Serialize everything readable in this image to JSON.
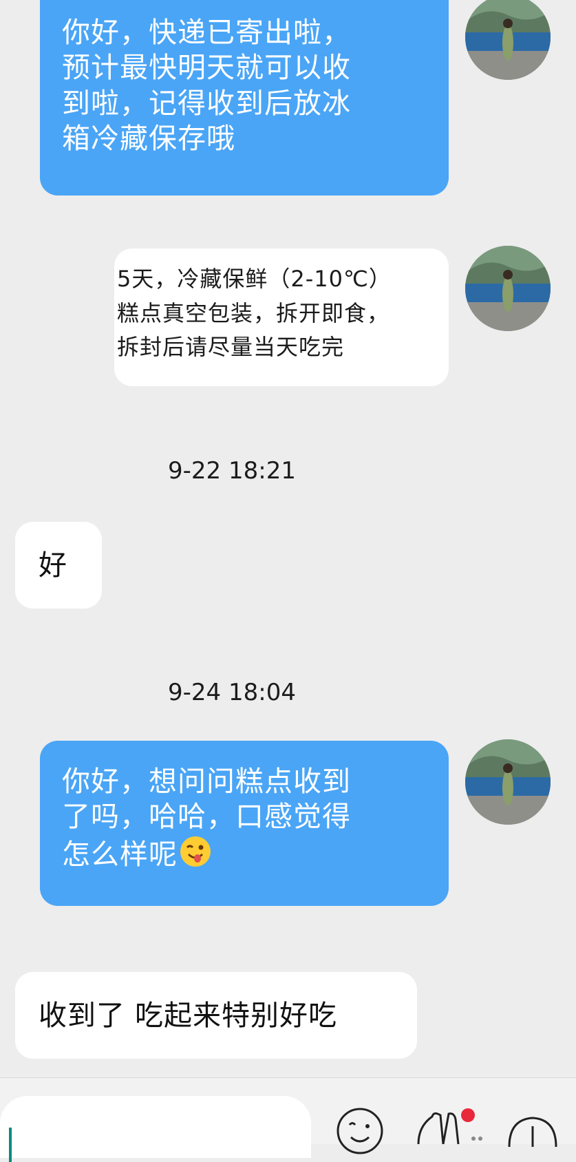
{
  "messages": [
    {
      "side": "right",
      "type": "text",
      "text": "你好，快递已寄出啦，预计最快明天就可以收到啦，记得收到后放冰箱冷藏保存哦"
    },
    {
      "side": "right",
      "type": "image-text",
      "lines": [
        "5天，冷藏保鲜（2-10℃）",
        "糕点真空包装，拆开即食，",
        "拆封后请尽量当天吃完"
      ]
    },
    {
      "side": "left",
      "type": "text",
      "text": "好"
    },
    {
      "side": "right",
      "type": "text",
      "text": "你好，想问问糕点收到了吗，哈哈，口感觉得怎么样呢",
      "emoji": "wink-tongue-emoji"
    },
    {
      "side": "left",
      "type": "text",
      "text": "收到了 吃起来特别好吃"
    }
  ],
  "timestamps": [
    "9-22 18:21",
    "9-24 18:04"
  ],
  "bubble1_lines": [
    "你好，快递已寄出啦，",
    "预计最快明天就可以收",
    "到啦，记得收到后放冰",
    "箱冷藏保存哦"
  ],
  "bubble4_lines": [
    "你好，想问问糕点收到",
    "了吗，哈哈，口感觉得",
    "怎么样呢"
  ],
  "reply_short": "好",
  "reply_long": "收到了 吃起来特别好吃",
  "input": {
    "value": "",
    "placeholder": ""
  },
  "toolbar": {
    "icons": [
      "emoji-icon",
      "more-icon",
      "voice-icon"
    ]
  },
  "colors": {
    "outgoing": "#4aa5f6",
    "incoming": "#ffffff",
    "background": "#ededed",
    "cursor": "#0b8a7e",
    "badge": "#e8283b"
  }
}
